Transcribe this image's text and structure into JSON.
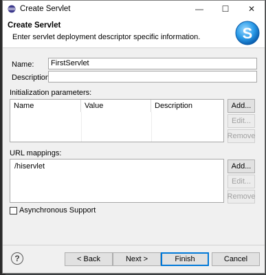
{
  "window": {
    "title": "Create Servlet",
    "minimize_glyph": "—",
    "maximize_glyph": "☐",
    "close_glyph": "✕"
  },
  "banner": {
    "title": "Create Servlet",
    "description": "Enter servlet deployment descriptor specific information.",
    "logo_letter": "S"
  },
  "form": {
    "name_label": "Name:",
    "name_value": "FirstServlet",
    "description_label": "Description:",
    "description_value": ""
  },
  "init_params": {
    "label": "Initialization parameters:",
    "columns": [
      "Name",
      "Value",
      "Description"
    ],
    "add_label": "Add...",
    "edit_label": "Edit...",
    "remove_label": "Remove"
  },
  "url_mappings": {
    "label": "URL mappings:",
    "items": [
      "/hiservlet"
    ],
    "add_label": "Add...",
    "edit_label": "Edit...",
    "remove_label": "Remove"
  },
  "async": {
    "label": "Asynchronous Support",
    "checked": false
  },
  "footer": {
    "help_glyph": "?",
    "back_label": "< Back",
    "next_label": "Next >",
    "finish_label": "Finish",
    "cancel_label": "Cancel"
  }
}
